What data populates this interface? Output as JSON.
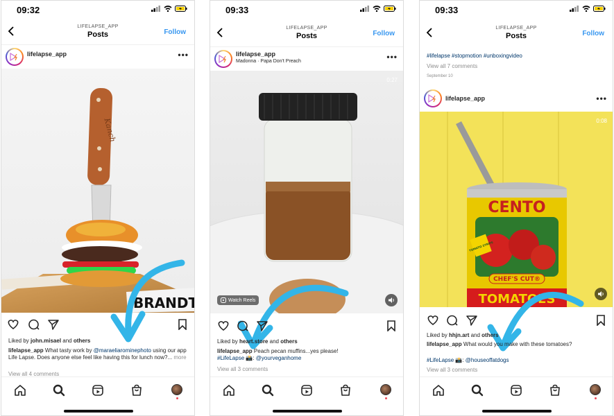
{
  "accent_colors": {
    "follow": "#3897f0",
    "arrow": "#33b5e8",
    "link": "#00376b",
    "notification": "#ed4956"
  },
  "screens": [
    {
      "status": {
        "time": "09:32"
      },
      "nav": {
        "account_label": "LIFELAPSE_APP",
        "title": "Posts",
        "follow": "Follow"
      },
      "post": {
        "username": "lifelapse_app",
        "liked_by_user": "john.misael",
        "liked_by_others": "others",
        "liked_prefix": "Liked by ",
        "liked_and": " and ",
        "caption_user": "lifelapse_app",
        "caption_text1": " What tasty work by ",
        "caption_mention": "@maraeliarominephoto",
        "caption_text2": " using our app Life Lapse. Does anyone else feel like having this for lunch now?...",
        "caption_more": " more",
        "view_all": "View all 4 comments",
        "board_text": "BRANDT",
        "knife_text": "Kanch"
      }
    },
    {
      "status": {
        "time": "09:33"
      },
      "nav": {
        "account_label": "LIFELAPSE_APP",
        "title": "Posts",
        "follow": "Follow"
      },
      "post": {
        "username": "lifelapse_app",
        "audio": "Madonna · Papa Don't Preach",
        "timer": "0:27",
        "watch_reels": "Watch Reels",
        "liked_prefix": "Liked by ",
        "liked_by_user": "heart.store",
        "liked_and": " and ",
        "liked_by_others": "others",
        "caption_user": "lifelapse_app",
        "caption_text1": " Peach pecan muffins...yes please!",
        "caption_tag": "#LifeLapse",
        "caption_emoji": " 📸: ",
        "caption_mention": "@yourveganhome",
        "view_all": "View all 3 comments"
      }
    },
    {
      "status": {
        "time": "09:33"
      },
      "nav": {
        "account_label": "LIFELAPSE_APP",
        "title": "Posts",
        "follow": "Follow"
      },
      "prev": {
        "tags": "#lifelapse #stopmotion #unboxingvideo",
        "view_all": "View all 7 comments",
        "date": "September 10"
      },
      "post": {
        "username": "lifelapse_app",
        "timer": "0:08",
        "can_brand": "CENTO",
        "can_sub": "CHEF'S CUT®",
        "can_bottom": "TOMATOES",
        "can_badge": "TOMATO STRIPS",
        "liked_prefix": "Liked by ",
        "liked_by_user": "hhjn.art",
        "liked_and": " and ",
        "liked_by_others": "others",
        "caption_user": "lifelapse_app",
        "caption_text1": " What would you make with these tomatoes?",
        "caption_tag": "#LifeLapse",
        "caption_emoji": " 📸: ",
        "caption_mention": "@houseoffatdogs",
        "view_all": "View all 3 comments"
      }
    }
  ]
}
